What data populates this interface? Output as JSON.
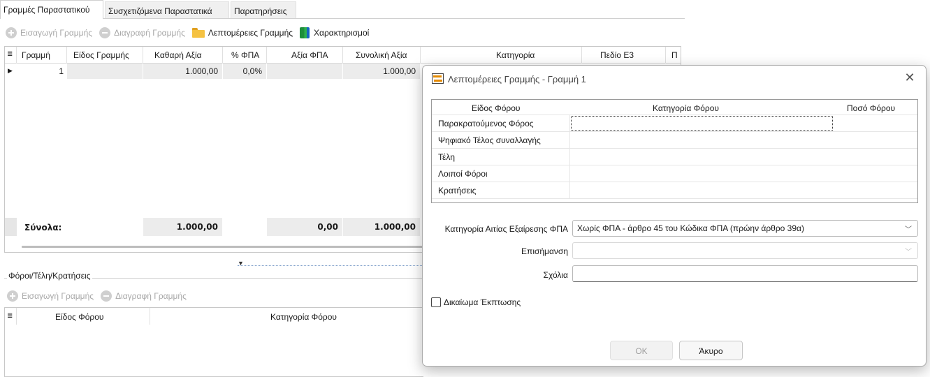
{
  "tabs": [
    {
      "label": "Γραμμές Παραστατικού"
    },
    {
      "label": "Συσχετιζόμενα Παραστατικά"
    },
    {
      "label": "Παρατηρήσεις"
    }
  ],
  "toolbar": {
    "insert_label": "Εισαγωγή Γραμμής",
    "delete_label": "Διαγραφή Γραμμής",
    "details_label": "Λεπτομέρειες Γραμμής",
    "attributes_label": "Χαρακτηρισμοί"
  },
  "lines_grid": {
    "columns": [
      "Γραμμή",
      "Είδος Γραμμής",
      "Καθαρή Αξία",
      "% ΦΠΑ",
      "Αξία ΦΠΑ",
      "Συνολική Αξία",
      "Κατηγορία",
      "Πεδίο Ε3",
      "Π"
    ],
    "rows": [
      {
        "line": "1",
        "type": "",
        "net": "1.000,00",
        "vat_pct": "0,0%",
        "vat": "",
        "total": "1.000,00"
      }
    ],
    "totals_label": "Σύνολα:",
    "totals": {
      "net": "1.000,00",
      "vat": "0,00",
      "total": "1.000,00"
    }
  },
  "taxes_section": {
    "legend": "Φόροι/Τέλη/Κρατήσεις",
    "insert_label": "Εισαγωγή Γραμμής",
    "delete_label": "Διαγραφή Γραμμής",
    "columns": [
      "Είδος Φόρου",
      "Κατηγορία Φόρου"
    ]
  },
  "dialog": {
    "title": "Λεπτομέρειες Γραμμής - Γραμμή 1",
    "tax_grid": {
      "columns": [
        "Είδος Φόρου",
        "Κατηγορία Φόρου",
        "Ποσό Φόρου"
      ],
      "rows": [
        {
          "label": "Παρακρατούμενος Φόρος"
        },
        {
          "label": "Ψηφιακό Τέλος συναλλαγής"
        },
        {
          "label": "Τέλη"
        },
        {
          "label": "Λοιποί Φόροι"
        },
        {
          "label": "Κρατήσεις"
        }
      ]
    },
    "vat_exemption_label": "Κατηγορία Αιτίας Εξαίρεσης ΦΠΑ",
    "vat_exemption_value": "Χωρίς ΦΠΑ - άρθρο 45 του Κώδικα ΦΠΑ (πρώην άρθρο 39α)",
    "note_label": "Επισήμανση",
    "note_value": "",
    "comments_label": "Σχόλια",
    "comments_value": "",
    "deduction_label": "Δικαίωμα Έκπτωσης",
    "deduction_checked": false,
    "ok_label": "OK",
    "cancel_label": "Άκυρο"
  }
}
